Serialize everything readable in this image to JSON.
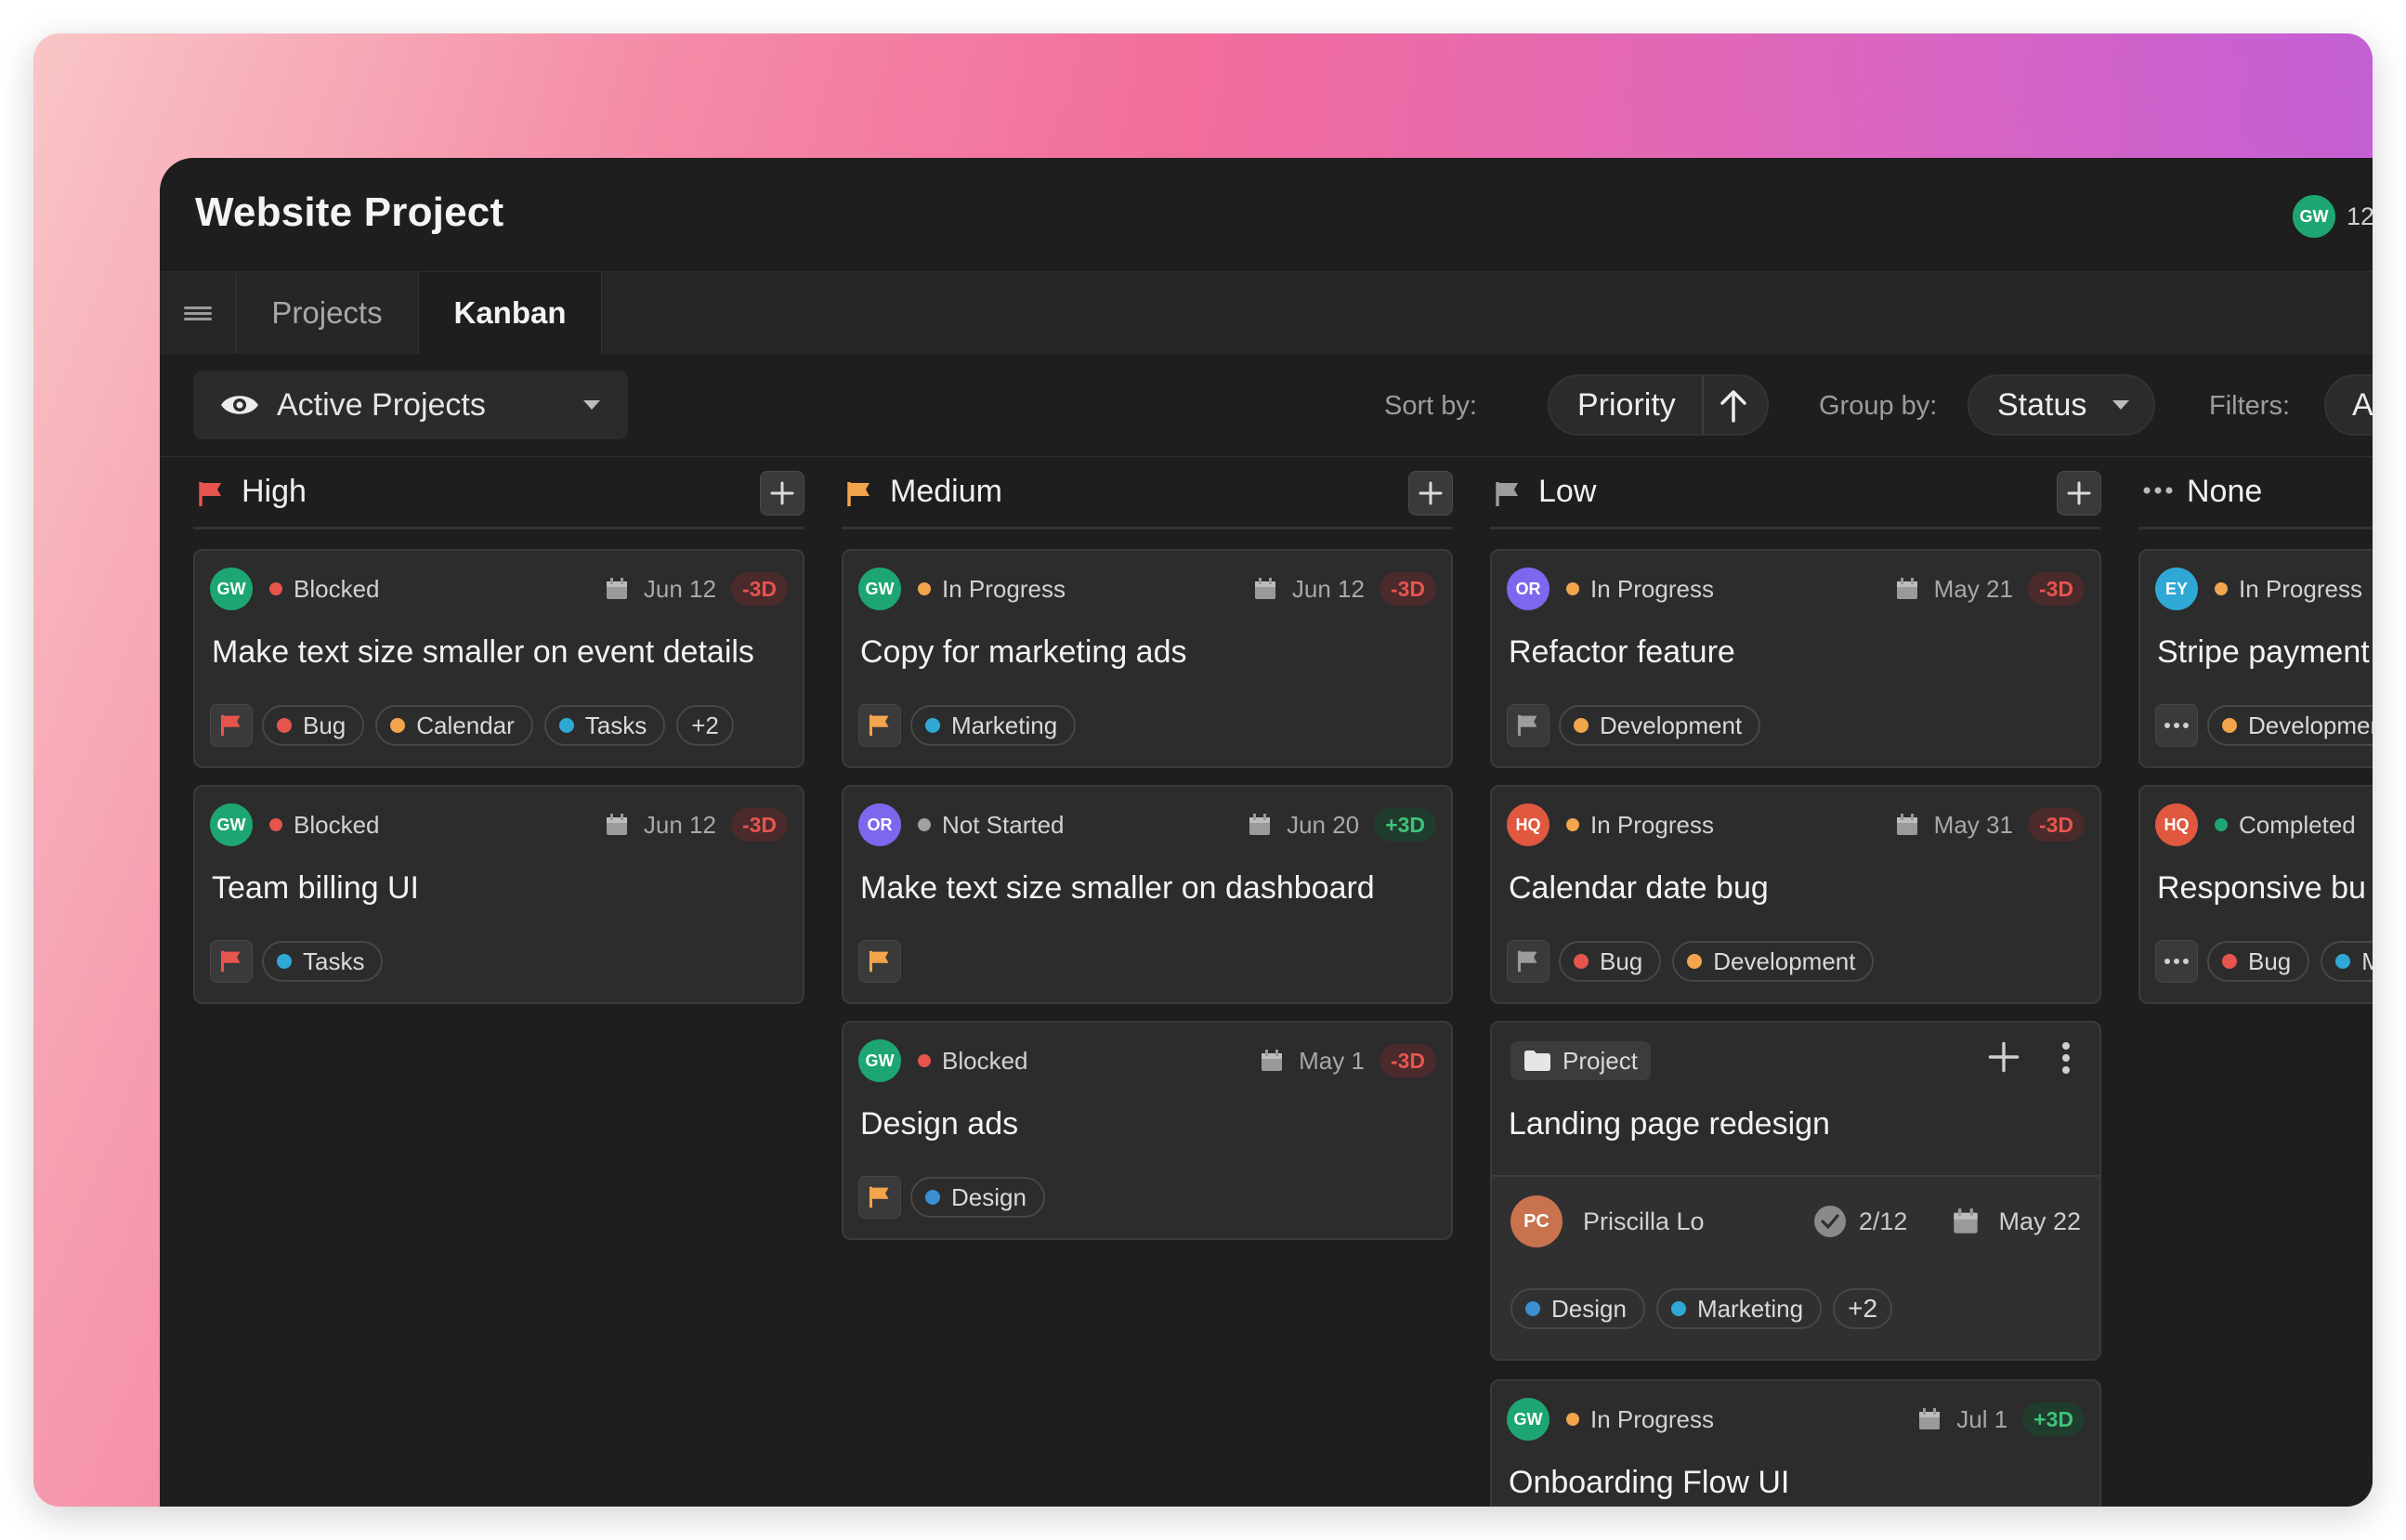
{
  "app": {
    "title": "Website Project",
    "header_user": {
      "initials": "GW",
      "count": "12"
    }
  },
  "tabs": [
    {
      "label": "Projects"
    },
    {
      "label": "Kanban"
    }
  ],
  "toolbar": {
    "view": "Active Projects",
    "sort_label": "Sort by:",
    "sort_value": "Priority",
    "group_label": "Group by:",
    "group_value": "Status",
    "filter_label": "Filters:",
    "filter_value": "Assi"
  },
  "colors": {
    "accent_green": "#1ea672",
    "neg": "#e5554e",
    "pos": "#3fc27a",
    "orange": "#f3a54d",
    "red": "#e5554e",
    "blue": "#2fa8d6"
  },
  "columns": [
    {
      "title": "High",
      "cards": [
        {
          "avatar": "GW",
          "status": "Blocked",
          "date": "Jun 12",
          "badge": "-3D",
          "title": "Make text size smaller on event details",
          "tags": [
            "Bug",
            "Calendar",
            "Tasks",
            "+2"
          ]
        },
        {
          "avatar": "GW",
          "status": "Blocked",
          "date": "Jun 12",
          "badge": "-3D",
          "title": "Team billing UI",
          "tags": [
            "Tasks"
          ]
        }
      ]
    },
    {
      "title": "Medium",
      "cards": [
        {
          "avatar": "GW",
          "status": "In Progress",
          "date": "Jun 12",
          "badge": "-3D",
          "title": "Copy for marketing ads",
          "tags": [
            "Marketing"
          ]
        },
        {
          "avatar": "OR",
          "status": "Not Started",
          "date": "Jun 20",
          "badge": "+3D",
          "title": "Make text size smaller on dashboard",
          "tags": []
        },
        {
          "avatar": "GW",
          "status": "Blocked",
          "date": "May 1",
          "badge": "-3D",
          "title": "Design ads",
          "tags": [
            "Design"
          ]
        }
      ]
    },
    {
      "title": "Low",
      "cards": [
        {
          "avatar": "OR",
          "status": "In Progress",
          "date": "May 21",
          "badge": "-3D",
          "title": "Refactor feature",
          "tags": [
            "Development"
          ]
        },
        {
          "avatar": "HQ",
          "status": "In Progress",
          "date": "May 31",
          "badge": "-3D",
          "title": "Calendar date bug",
          "tags": [
            "Bug",
            "Development"
          ]
        },
        {
          "type": "Project",
          "title": "Landing page redesign",
          "owner": "Priscilla Lo",
          "owner_initials": "PC",
          "progress": "2/12",
          "date": "May 22",
          "tags": [
            "Design",
            "Marketing",
            "+2"
          ]
        },
        {
          "avatar": "GW",
          "status": "In Progress",
          "date": "Jul 1",
          "badge": "+3D",
          "title": "Onboarding Flow UI"
        }
      ]
    },
    {
      "title": "None",
      "cards": [
        {
          "avatar": "EY",
          "status": "In Progress",
          "title": "Stripe payment",
          "tags": [
            "Development"
          ]
        },
        {
          "avatar": "HQ",
          "status": "Completed",
          "title": "Responsive bu",
          "tags": [
            "Bug",
            "M"
          ]
        }
      ]
    }
  ]
}
